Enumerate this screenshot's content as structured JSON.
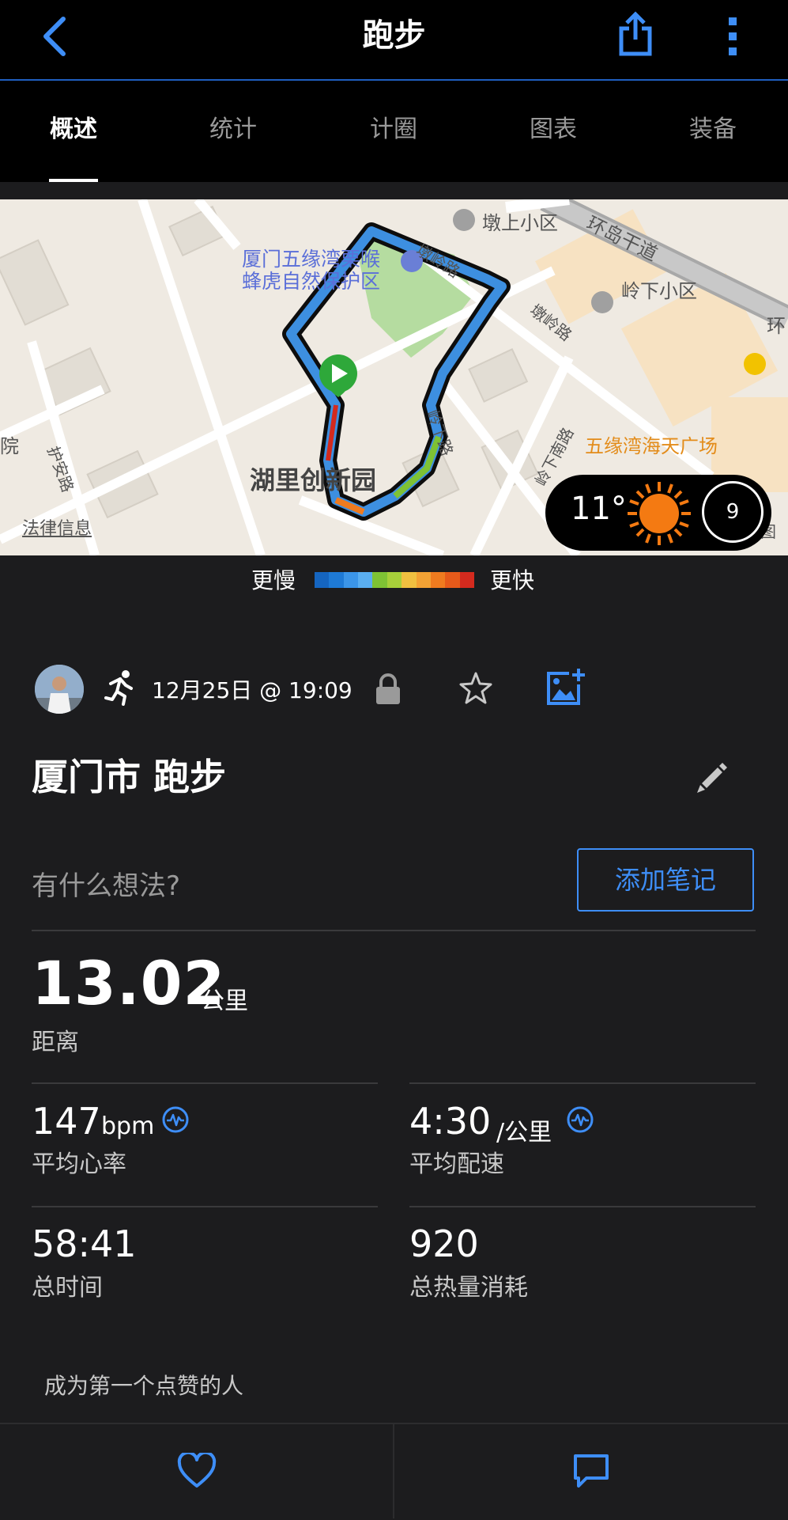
{
  "header": {
    "title": "跑步"
  },
  "tabs": [
    {
      "label": "概述"
    },
    {
      "label": "统计"
    },
    {
      "label": "计圈"
    },
    {
      "label": "图表"
    },
    {
      "label": "装备"
    }
  ],
  "map": {
    "labels": {
      "nature_reserve_line1": "厦门五缘湾栗喉",
      "nature_reserve_line2": "蜂虎自然保护区",
      "dunshang": "墩上小区",
      "lingxia": "岭下小区",
      "huandao": "环岛干道",
      "dunling_road": "墩岭路",
      "dunling_road2": "墩岭路",
      "lingxia_road": "岭下路",
      "lingxia_south_road": "岭下南路",
      "huli_park": "湖里创新园",
      "wuyuanwan_plaza": "五缘湾海天广场",
      "huan": "环",
      "hu_an_road": "护安路",
      "left_edge": "院",
      "right_edge": "图"
    },
    "legal_info": "法律信息",
    "weather": {
      "temperature": "11°",
      "wind_speed": "9"
    }
  },
  "pace_legend": {
    "slow_label": "更慢",
    "fast_label": "更快",
    "colors": [
      "#1565c0",
      "#1e7ad6",
      "#3b95e8",
      "#5aaef0",
      "#7ec234",
      "#a7cf3a",
      "#f0c040",
      "#f3a234",
      "#ef7b1f",
      "#e65a1a",
      "#d42a1e"
    ]
  },
  "activity": {
    "datetime": "12月25日 @ 19:09",
    "title": "厦门市 跑步",
    "thoughts_placeholder": "有什么想法?",
    "add_note_label": "添加笔记"
  },
  "stats": {
    "distance": {
      "value": "13.02",
      "unit": "公里",
      "label": "距离"
    },
    "avg_hr": {
      "value": "147",
      "unit": "bpm",
      "label": "平均心率"
    },
    "avg_pace": {
      "value": "4:30",
      "unit": "/公里",
      "label": "平均配速"
    },
    "total_time": {
      "value": "58:41",
      "label": "总时间"
    },
    "calories": {
      "value": "920",
      "label": "总热量消耗"
    }
  },
  "social": {
    "kudos_text": "成为第一个点赞的人"
  },
  "colors": {
    "accent": "#3e8ef7",
    "background": "#1c1c1e",
    "header": "#000000"
  }
}
